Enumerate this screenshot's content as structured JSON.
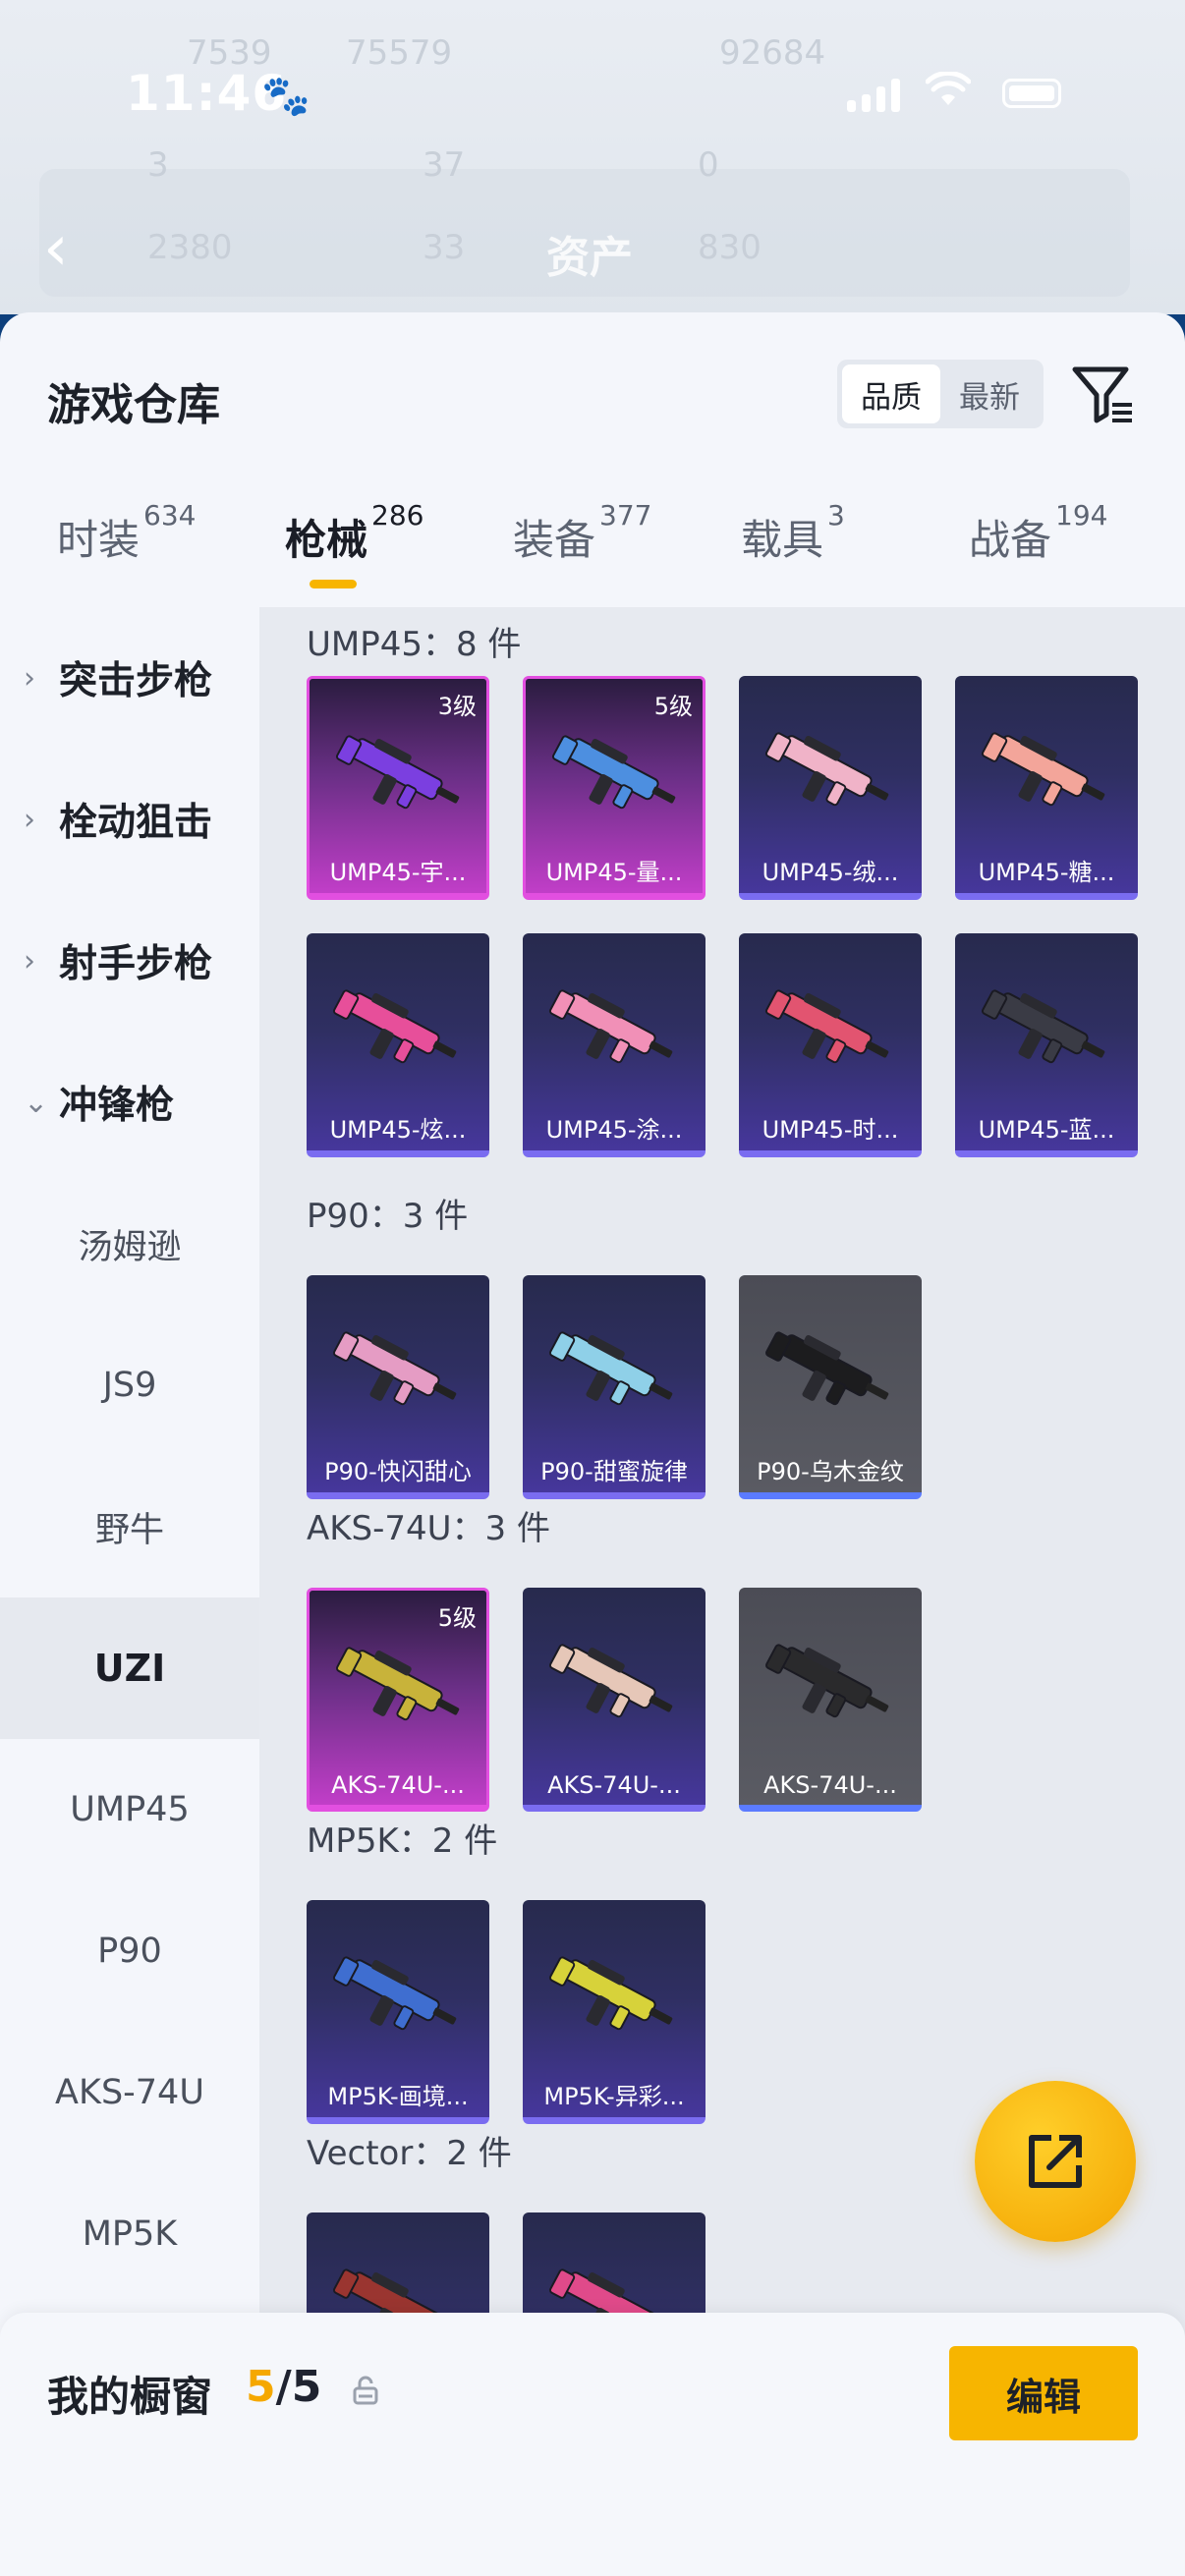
{
  "status_bar": {
    "time": "11:46"
  },
  "header": {
    "title": "资产"
  },
  "background_stats": [
    "7539",
    "75579",
    "92684",
    "3",
    "37",
    "0",
    "2380",
    "33",
    "830"
  ],
  "sheet": {
    "title": "游戏仓库",
    "sort": {
      "options": [
        "品质",
        "最新"
      ],
      "active": "品质"
    }
  },
  "tabs": [
    {
      "label": "时装",
      "count": "634"
    },
    {
      "label": "枪械",
      "count": "286",
      "active": true
    },
    {
      "label": "装备",
      "count": "377"
    },
    {
      "label": "载具",
      "count": "3"
    },
    {
      "label": "战备",
      "count": "194"
    }
  ],
  "sidebar": {
    "categories": [
      "突击步枪",
      "栓动狙击",
      "射手步枪",
      "冲锋枪"
    ],
    "subitems": [
      "汤姆逊",
      "JS9",
      "野牛",
      "UZI",
      "UMP45",
      "P90",
      "AKS-74U",
      "MP5K"
    ],
    "selected": "UZI"
  },
  "groups": [
    {
      "label": "UMP45：8 件",
      "items": [
        {
          "name": "UMP45-宇...",
          "level": "3级",
          "style": "magenta",
          "color": "#7b3fe0"
        },
        {
          "name": "UMP45-量...",
          "level": "5级",
          "style": "magenta",
          "color": "#4d8fe0"
        },
        {
          "name": "UMP45-绒...",
          "level": "",
          "style": "purple",
          "color": "#f0b3c8"
        },
        {
          "name": "UMP45-糖...",
          "level": "",
          "style": "purple",
          "color": "#f3a59a"
        },
        {
          "name": "UMP45-炫...",
          "level": "",
          "style": "purple",
          "color": "#e74f9a"
        },
        {
          "name": "UMP45-涂...",
          "level": "",
          "style": "purple",
          "color": "#f190b7"
        },
        {
          "name": "UMP45-时...",
          "level": "",
          "style": "purple",
          "color": "#e25470"
        },
        {
          "name": "UMP45-蓝...",
          "level": "",
          "style": "purple",
          "color": "#3a3b45"
        }
      ]
    },
    {
      "label": "P90：3 件",
      "items": [
        {
          "name": "P90-快闪甜心",
          "level": "",
          "style": "purple",
          "color": "#e59cc4"
        },
        {
          "name": "P90-甜蜜旋律",
          "level": "",
          "style": "purple",
          "color": "#8fd0e8"
        },
        {
          "name": "P90-乌木金纹",
          "level": "",
          "style": "gray",
          "color": "#1c1c1e"
        }
      ]
    },
    {
      "label": "AKS-74U：3 件",
      "items": [
        {
          "name": "AKS-74U-...",
          "level": "5级",
          "style": "magenta",
          "color": "#c8b33a"
        },
        {
          "name": "AKS-74U-...",
          "level": "",
          "style": "purple",
          "color": "#e6c7b8"
        },
        {
          "name": "AKS-74U-...",
          "level": "",
          "style": "gray",
          "color": "#2a2a2c"
        }
      ]
    },
    {
      "label": "MP5K：2 件",
      "items": [
        {
          "name": "MP5K-画境...",
          "level": "",
          "style": "purple",
          "color": "#3f6ed0"
        },
        {
          "name": "MP5K-异彩...",
          "level": "",
          "style": "purple",
          "color": "#d7d23a"
        }
      ]
    },
    {
      "label": "Vector：2 件",
      "items": [
        {
          "name": "",
          "level": "",
          "style": "purple",
          "color": "#9a3530"
        },
        {
          "name": "",
          "level": "",
          "style": "purple",
          "color": "#e04a8a"
        }
      ]
    }
  ],
  "bottom": {
    "showcase_label": "我的橱窗",
    "showcase_current": "5",
    "showcase_sep_total": "/5",
    "edit_label": "编辑"
  },
  "colors": {
    "accent": "#f7b500",
    "rare": "#e24fe0",
    "common": "#7a6cf0"
  }
}
